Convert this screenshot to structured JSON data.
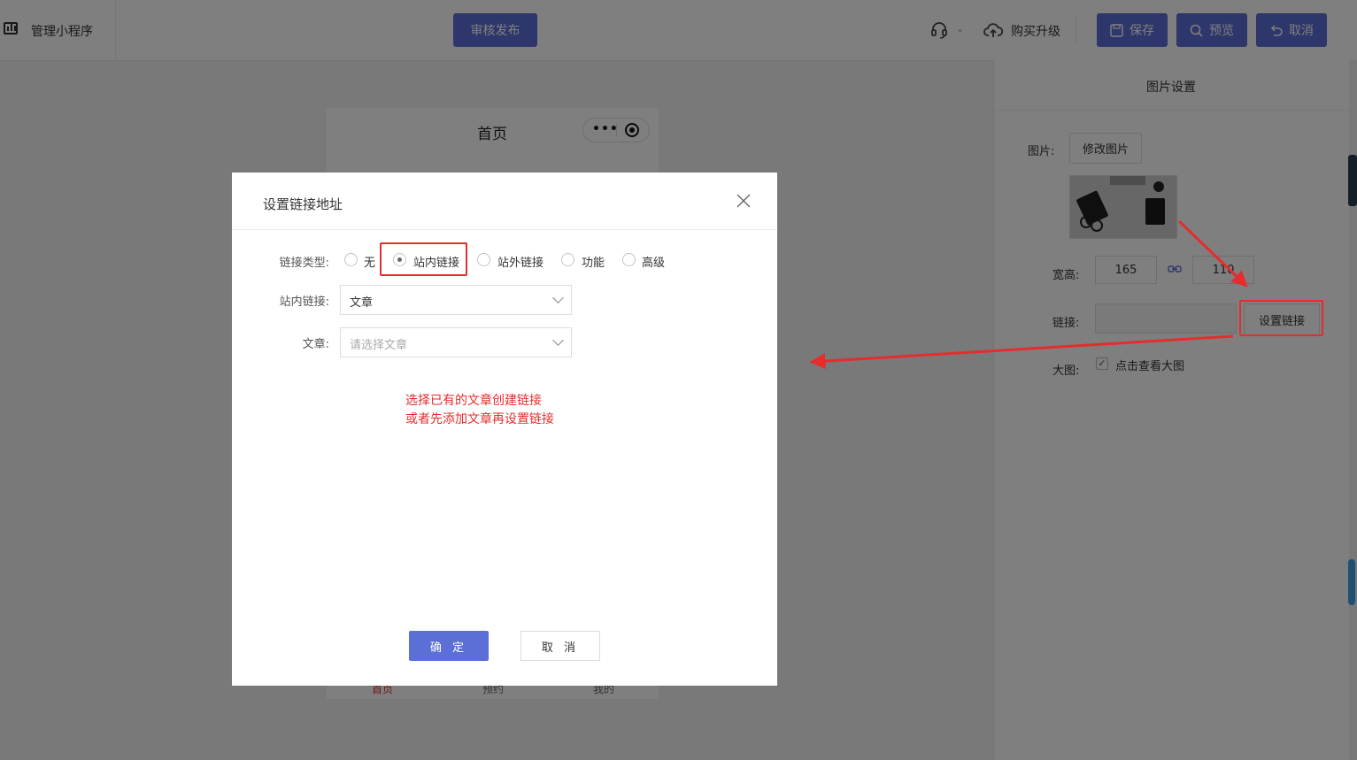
{
  "app": {
    "title": "管理小程序"
  },
  "toolbar": {
    "publish_label": "审核发布",
    "upgrade_label": "购买升级",
    "save_label": "保存",
    "preview_label": "预览",
    "cancel_label": "取消"
  },
  "phone": {
    "page_title": "首页",
    "tabbar": [
      "首页",
      "预约",
      "我的"
    ]
  },
  "right_panel": {
    "title": "图片设置",
    "image_label": "图片:",
    "change_image_label": "修改图片",
    "size_label": "宽高:",
    "width": "165",
    "height": "110",
    "link_label": "链接:",
    "link_value": "",
    "set_link_label": "设置链接",
    "large_label": "大图:",
    "large_check_text": "点击查看大图",
    "large_checked": true
  },
  "dialog": {
    "title": "设置链接地址",
    "type_label": "链接类型:",
    "types": [
      "无",
      "站内链接",
      "站外链接",
      "功能",
      "高级"
    ],
    "selected_type": "站内链接",
    "internal_label": "站内链接:",
    "internal_value": "文章",
    "article_label": "文章:",
    "article_placeholder": "请选择文章",
    "note_line1": "选择已有的文章创建链接",
    "note_line2": "或者先添加文章再设置链接",
    "ok_label": "确 定",
    "cancel_label": "取 消"
  },
  "colors": {
    "primary": "#5b6fd6",
    "annotation_red": "#e62c2c",
    "overlay": "rgba(0,0,0,0.5)"
  },
  "icons": [
    "chart-icon",
    "headset-icon",
    "cloud-upload-icon",
    "save-icon",
    "search-icon",
    "undo-icon",
    "close-icon",
    "chain-link-icon",
    "more-dots-icon",
    "target-icon",
    "chevron-down-icon",
    "checkmark-icon"
  ]
}
